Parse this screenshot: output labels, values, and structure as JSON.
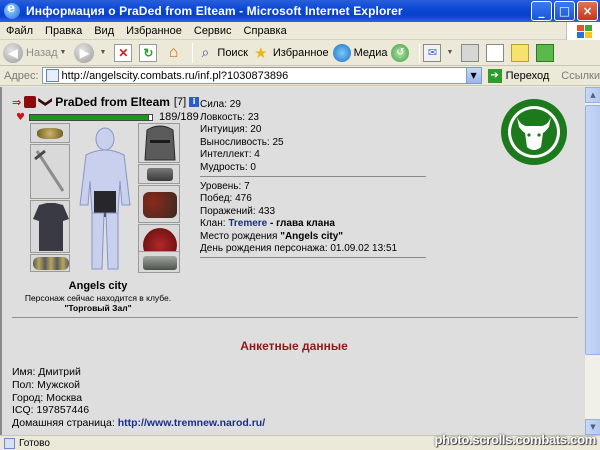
{
  "window": {
    "title": "Информация о PraDed from Elteam - Microsoft Internet Explorer",
    "buttons": [
      "_",
      "□",
      "×"
    ]
  },
  "menu": [
    "Файл",
    "Правка",
    "Вид",
    "Избранное",
    "Сервис",
    "Справка"
  ],
  "toolbar": {
    "back": "Назад",
    "search": "Поиск",
    "favorites": "Избранное",
    "media": "Медиа"
  },
  "address": {
    "label": "Адрес:",
    "url": "http://angelscity.combats.ru/inf.pl?1030873896",
    "go": "Переход",
    "links": "Ссылки"
  },
  "character": {
    "name": "PraDed from Elteam",
    "level": "[7]",
    "hp": "189/189",
    "hp_fraction": 1.0,
    "location_city": "Angels city",
    "location_note": "Персонаж сейчас находится в клубе.",
    "location_place": "\"Торговый Зал\""
  },
  "stats": [
    "Сила: 29",
    "Ловкость: 23",
    "Интуиция: 20",
    "Выносливость: 25",
    "Интеллект: 4",
    "Мудрость: 0"
  ],
  "info": {
    "level": "Уровень: 7",
    "wins": "Побед: 476",
    "losses": "Поражений: 433",
    "clan_label": "Клан:",
    "clan_name": "Tremere",
    "clan_role": " - глава клана",
    "birthplace_label": "Место рождения ",
    "birthplace": "\"Angels city\"",
    "birthday": "День рождения персонажа: 01.09.02 13:51"
  },
  "anketa": {
    "title": "Анкетные данные",
    "name": "Имя: Дмитрий",
    "sex": "Пол: Мужской",
    "city": "Город: Москва",
    "icq": "ICQ: 197857446",
    "homepage_label": "Домашняя страница: ",
    "homepage": "http://www.tremnew.narod.ru/"
  },
  "status": {
    "text": "Готово",
    "watermark": "photo.scrolls.combats.com"
  },
  "colors": {
    "titlebar": "#0a48d6",
    "hp_bar": "#189a18",
    "emblem": "#1c7a1c",
    "anketa_title": "#8b1a1a",
    "link": "#1a2f8a"
  }
}
